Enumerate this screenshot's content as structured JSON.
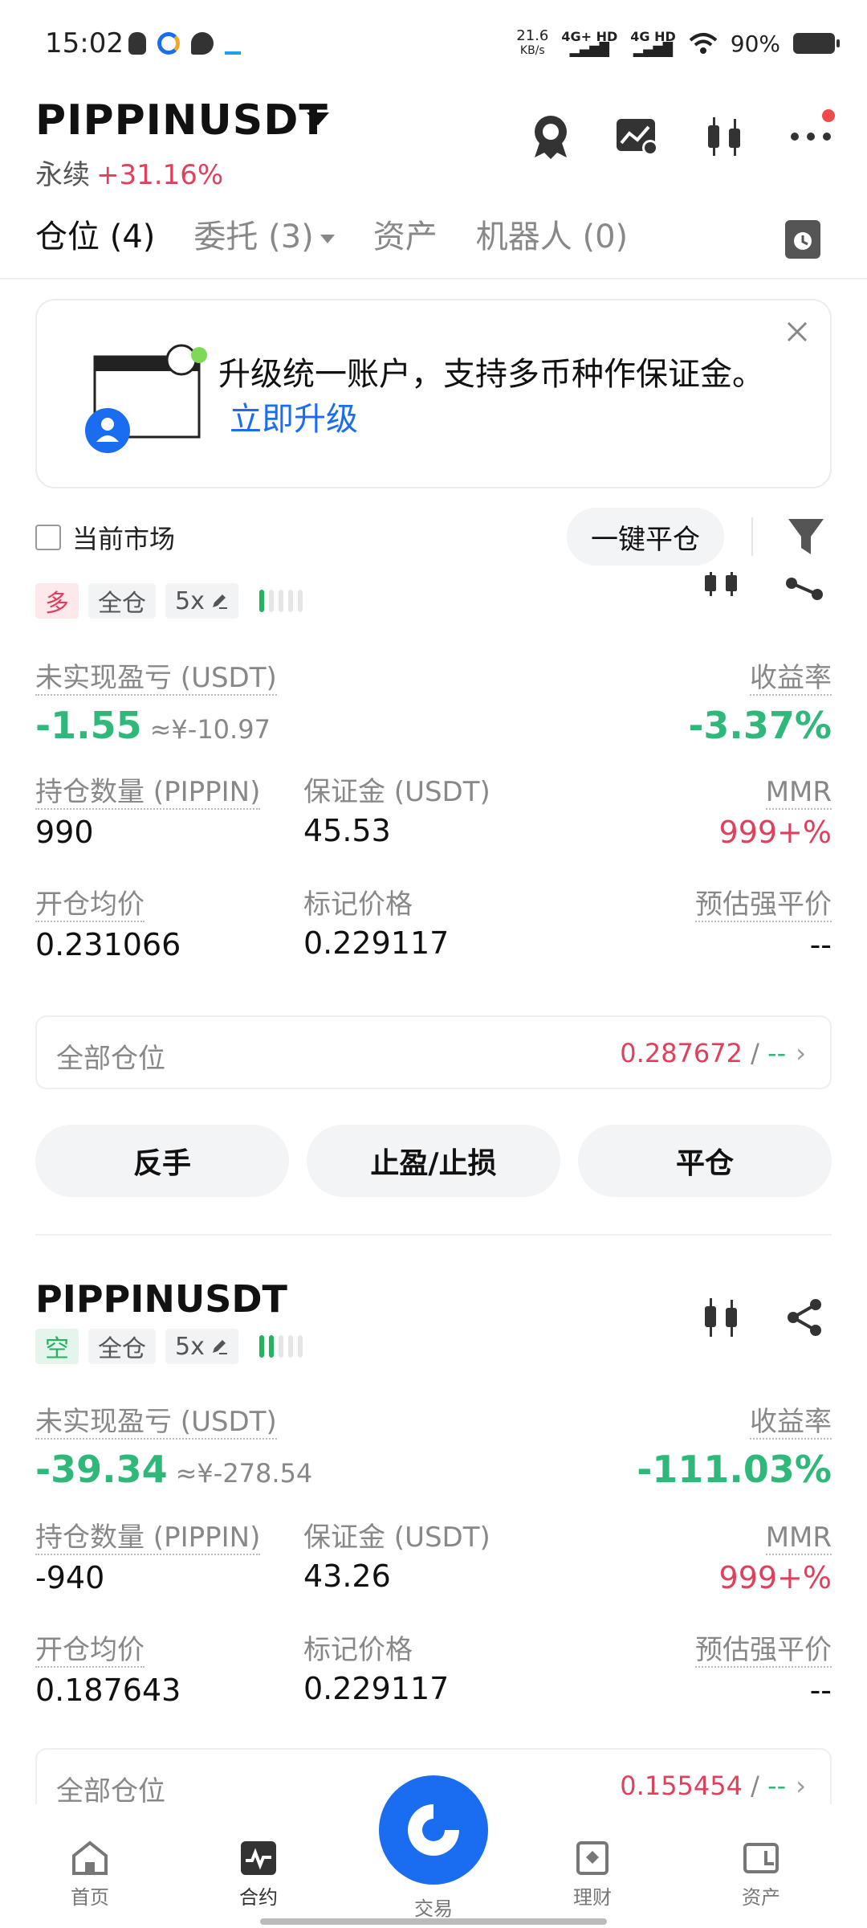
{
  "status_bar": {
    "time": "15:02",
    "speed": "21.6",
    "speed_unit": "KB/s",
    "sig1": "4G+ HD",
    "sig2": "4G HD",
    "battery": "90%"
  },
  "header": {
    "title": "PIPPINUSDT",
    "type": "永续",
    "change": "+31.16%"
  },
  "tabs": [
    {
      "label": "仓位 (4)"
    },
    {
      "label": "委托 (3)"
    },
    {
      "label": "资产"
    },
    {
      "label": "机器人 (0)"
    }
  ],
  "banner": {
    "message": "升级统一账户，支持多币种作保证金。",
    "link": "立即升级"
  },
  "filter": {
    "current_market": "当前市场",
    "close_all": "一键平仓"
  },
  "positions": [
    {
      "name": "PIPPINUSDT",
      "side": "多",
      "margin_mode": "全仓",
      "leverage": "5x",
      "unrealized_label": "未实现盈亏 (USDT)",
      "unrealized": "-1.55",
      "unrealized_cny": "≈¥-10.97",
      "roe_label": "收益率",
      "roe": "-3.37%",
      "size_label": "持仓数量 (PIPPIN)",
      "size": "990",
      "margin_label": "保证金 (USDT)",
      "margin": "45.53",
      "mmr_label": "MMR",
      "mmr": "999+%",
      "entry_label": "开仓均价",
      "entry": "0.231066",
      "mark_label": "标记价格",
      "mark": "0.229117",
      "liq_label": "预估强平价",
      "liq": "--",
      "all_label": "全部仓位",
      "all_price": "0.287672",
      "all_sep": "/",
      "all_other": "--"
    },
    {
      "name": "PIPPINUSDT",
      "side": "空",
      "margin_mode": "全仓",
      "leverage": "5x",
      "unrealized_label": "未实现盈亏 (USDT)",
      "unrealized": "-39.34",
      "unrealized_cny": "≈¥-278.54",
      "roe_label": "收益率",
      "roe": "-111.03%",
      "size_label": "持仓数量 (PIPPIN)",
      "size": "-940",
      "margin_label": "保证金 (USDT)",
      "margin": "43.26",
      "mmr_label": "MMR",
      "mmr": "999+%",
      "entry_label": "开仓均价",
      "entry": "0.187643",
      "mark_label": "标记价格",
      "mark": "0.229117",
      "liq_label": "预估强平价",
      "liq": "--",
      "all_label": "全部仓位",
      "all_price": "0.155454",
      "all_sep": "/",
      "all_other": "--"
    }
  ],
  "actions": {
    "reverse": "反手",
    "tp_sl": "止盈/止损",
    "close": "平仓"
  },
  "nav": [
    {
      "label": "首页"
    },
    {
      "label": "合约"
    },
    {
      "label": "交易"
    },
    {
      "label": "理财"
    },
    {
      "label": "资产"
    }
  ],
  "colors": {
    "accent_blue": "#1a6cf0",
    "up_green": "#2fb87a",
    "down_red": "#e0405c"
  }
}
